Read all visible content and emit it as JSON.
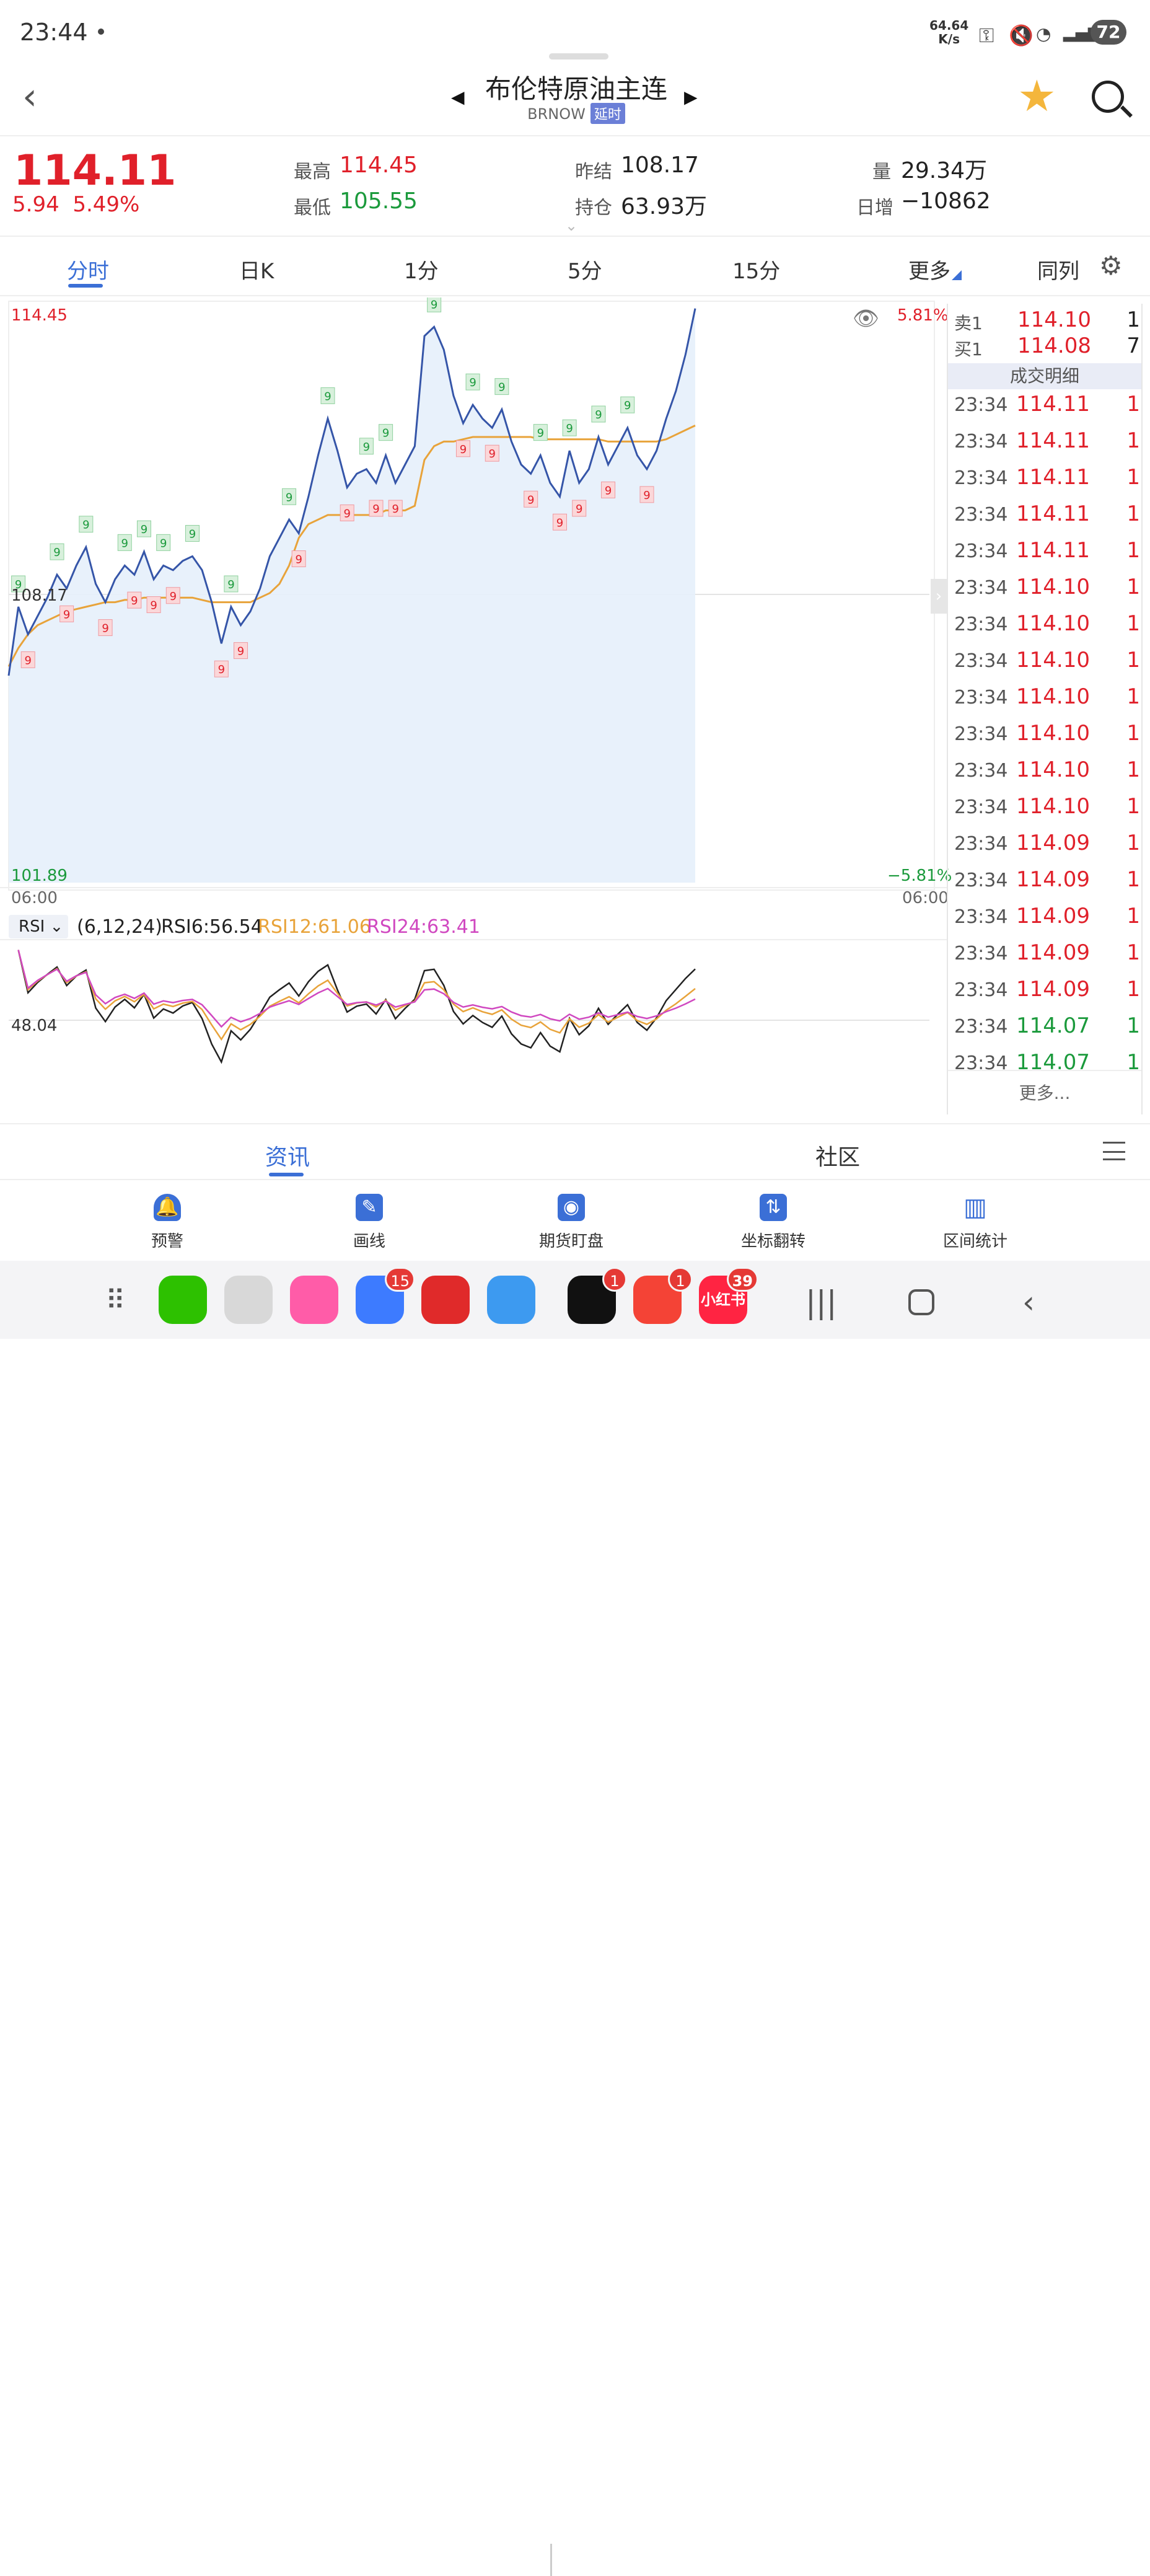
{
  "status": {
    "time": "23:44",
    "speed": "64.64\nK/s",
    "battery": "72"
  },
  "header": {
    "title": "布伦特原油主连",
    "code": "BRNOW",
    "tag": "延时"
  },
  "quote": {
    "price": "114.11",
    "change": "5.94",
    "change_pct": "5.49%",
    "high_label": "最高",
    "high": "114.45",
    "low_label": "最低",
    "low": "105.55",
    "prev_label": "昨结",
    "prev": "108.17",
    "oi_label": "持仓",
    "oi": "63.93万",
    "vol_label": "量",
    "vol": "29.34万",
    "daily_label": "日增",
    "daily": "−10862"
  },
  "tabs": [
    "分时",
    "日K",
    "1分",
    "5分",
    "15分",
    "更多",
    "同列"
  ],
  "chart": {
    "top_price": "114.45",
    "bottom_price": "101.89",
    "ref_price": "108.17",
    "top_pct": "5.81%",
    "bottom_pct": "−5.81%",
    "time_start": "06:00",
    "time_end": "06:00",
    "rsi_mid": "48.04",
    "signal_label": "9"
  },
  "chart_data": {
    "type": "line",
    "ylim": [
      101.89,
      114.45
    ],
    "prev_close": 108.17,
    "series": [
      {
        "values": [
          106.4,
          107.9,
          107.3,
          107.7,
          108.1,
          108.6,
          108.3,
          108.8,
          109.2,
          108.4,
          108.0,
          108.5,
          108.8,
          108.6,
          109.1,
          108.5,
          108.8,
          108.7,
          108.9,
          109.0,
          108.7,
          108.0,
          107.1,
          107.9,
          107.5,
          107.8,
          108.3,
          109.0,
          109.4,
          109.8,
          109.5,
          110.3,
          111.2,
          112.0,
          111.3,
          110.5,
          110.8,
          110.9,
          110.6,
          111.2,
          110.6,
          111.0,
          111.4,
          113.8,
          114.0,
          113.5,
          112.5,
          111.9,
          112.3,
          112.0,
          111.8,
          112.2,
          111.5,
          111.0,
          110.8,
          111.2,
          110.6,
          110.3,
          111.3,
          110.6,
          110.9,
          111.6,
          111.0,
          111.4,
          111.8,
          111.2,
          110.9,
          111.3,
          112.0,
          112.6,
          113.4,
          114.4
        ]
      },
      {
        "values": [
          106.6,
          107.0,
          107.3,
          107.5,
          107.6,
          107.7,
          107.8,
          107.85,
          107.9,
          107.95,
          108.0,
          108.0,
          108.05,
          108.05,
          108.1,
          108.1,
          108.1,
          108.1,
          108.1,
          108.1,
          108.05,
          108.0,
          108.0,
          108.0,
          108.0,
          108.0,
          108.1,
          108.2,
          108.4,
          108.8,
          109.4,
          109.7,
          109.8,
          109.9,
          109.9,
          109.9,
          109.9,
          109.9,
          109.9,
          110.0,
          110.0,
          110.0,
          110.1,
          111.1,
          111.4,
          111.5,
          111.5,
          111.55,
          111.6,
          111.6,
          111.6,
          111.6,
          111.6,
          111.6,
          111.6,
          111.55,
          111.55,
          111.55,
          111.55,
          111.55,
          111.55,
          111.55,
          111.5,
          111.5,
          111.5,
          111.5,
          111.5,
          111.5,
          111.55,
          111.65,
          111.75,
          111.85
        ]
      }
    ],
    "rsi": {
      "params": "(6,12,24)",
      "rsi6": "RSI6:56.54",
      "rsi12": "RSI12:61.06",
      "rsi24": "RSI24:63.41"
    }
  },
  "orderbook": {
    "sell_label": "卖1",
    "sell_price": "114.10",
    "sell_qty": "1",
    "buy_label": "买1",
    "buy_price": "114.08",
    "buy_qty": "7",
    "detail_header": "成交明细",
    "trades": [
      {
        "t": "23:34",
        "p": "114.11",
        "q": "1"
      },
      {
        "t": "23:34",
        "p": "114.11",
        "q": "1"
      },
      {
        "t": "23:34",
        "p": "114.11",
        "q": "1"
      },
      {
        "t": "23:34",
        "p": "114.11",
        "q": "1"
      },
      {
        "t": "23:34",
        "p": "114.11",
        "q": "1"
      },
      {
        "t": "23:34",
        "p": "114.10",
        "q": "1"
      },
      {
        "t": "23:34",
        "p": "114.10",
        "q": "1"
      },
      {
        "t": "23:34",
        "p": "114.10",
        "q": "1"
      },
      {
        "t": "23:34",
        "p": "114.10",
        "q": "1"
      },
      {
        "t": "23:34",
        "p": "114.10",
        "q": "1"
      },
      {
        "t": "23:34",
        "p": "114.10",
        "q": "1"
      },
      {
        "t": "23:34",
        "p": "114.10",
        "q": "1"
      },
      {
        "t": "23:34",
        "p": "114.09",
        "q": "1"
      },
      {
        "t": "23:34",
        "p": "114.09",
        "q": "1"
      },
      {
        "t": "23:34",
        "p": "114.09",
        "q": "1"
      },
      {
        "t": "23:34",
        "p": "114.09",
        "q": "1"
      },
      {
        "t": "23:34",
        "p": "114.09",
        "q": "1"
      },
      {
        "t": "23:34",
        "p": "114.07",
        "q": "1",
        "green": true
      },
      {
        "t": "23:34",
        "p": "114.07",
        "q": "1",
        "green": true
      }
    ],
    "more": "更多..."
  },
  "bottom_tabs": [
    "资讯",
    "社区"
  ],
  "tools": [
    "预警",
    "画线",
    "期货盯盘",
    "坐标翻转",
    "区间统计"
  ],
  "dock": {
    "badges": [
      "15",
      "1",
      "1",
      "39"
    ],
    "xhs_label": "小红书"
  },
  "colors": {
    "up": "#e0202a",
    "down": "#1b9a3c",
    "accent": "#3b6fd6",
    "price_line": "#3555a8",
    "avg_line": "#e8a33a"
  }
}
